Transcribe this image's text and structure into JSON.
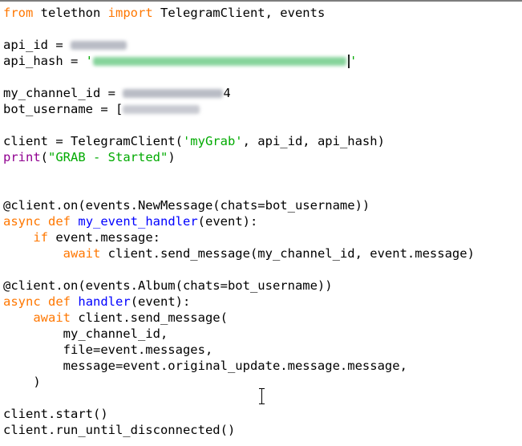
{
  "editor": {
    "lines": [
      [
        "from",
        " telethon ",
        "import",
        " TelegramClient, events"
      ],
      [
        ""
      ],
      [
        "api_id = "
      ],
      [
        "api_hash = ",
        "'",
        "'"
      ],
      [
        ""
      ],
      [
        "my_channel_id = ",
        "4"
      ],
      [
        "bot_username = ["
      ],
      [
        ""
      ],
      [
        "client = TelegramClient(",
        "'myGrab'",
        ", api_id, api_hash)"
      ],
      [
        "print",
        "(",
        "\"GRAB - Started\"",
        ")"
      ],
      [
        ""
      ],
      [
        ""
      ],
      [
        "@client.on(events.NewMessage(chats=bot_username))"
      ],
      [
        "async",
        " ",
        "def",
        " ",
        "my_event_handler",
        "(event):"
      ],
      [
        "    ",
        "if",
        " event.message:"
      ],
      [
        "        ",
        "await",
        " client.send_message(my_channel_id, event.message)"
      ],
      [
        ""
      ],
      [
        "@client.on(events.Album(chats=bot_username))"
      ],
      [
        "async",
        " ",
        "def",
        " ",
        "handler",
        "(event):"
      ],
      [
        "    ",
        "await",
        " client.send_message("
      ],
      [
        "        my_channel_id,"
      ],
      [
        "        file=event.messages,"
      ],
      [
        "        message=event.original_update.message.message,"
      ],
      [
        "    )"
      ],
      [
        ""
      ],
      [
        "client.start()"
      ],
      [
        "client.run_until_disconnected()"
      ]
    ],
    "colors": {
      "keyword": "#ff7700",
      "function_name": "#0000ff",
      "string": "#00aa00",
      "builtin": "#900090",
      "text": "#000000",
      "background": "#ffffff"
    },
    "icons": {
      "mouse_cursor": "i-beam-cursor-icon",
      "text_caret": "text-caret"
    }
  }
}
